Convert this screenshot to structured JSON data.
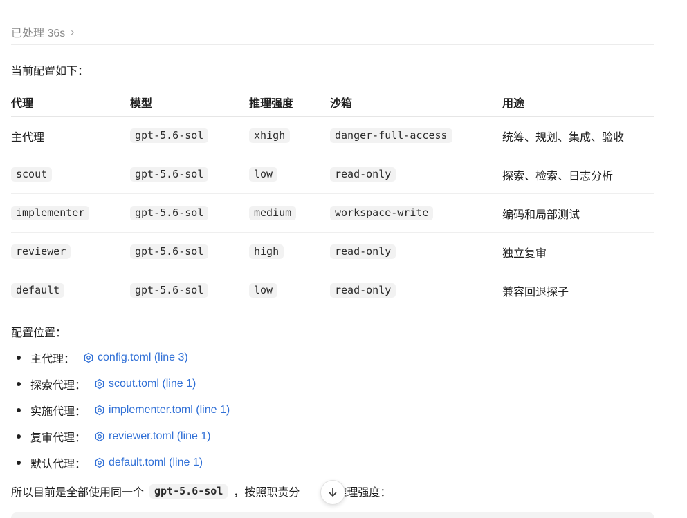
{
  "status": {
    "processed_label": "已处理 36s",
    "chevron": "›"
  },
  "intro": "当前配置如下：",
  "table": {
    "headers": [
      "代理",
      "模型",
      "推理强度",
      "沙箱",
      "用途"
    ],
    "rows": [
      {
        "agent": "主代理",
        "agent_is_code": false,
        "model": "gpt-5.6-sol",
        "effort": "xhigh",
        "sandbox": "danger-full-access",
        "usage": "统筹、规划、集成、验收"
      },
      {
        "agent": "scout",
        "agent_is_code": true,
        "model": "gpt-5.6-sol",
        "effort": "low",
        "sandbox": "read-only",
        "usage": "探索、检索、日志分析"
      },
      {
        "agent": "implementer",
        "agent_is_code": true,
        "model": "gpt-5.6-sol",
        "effort": "medium",
        "sandbox": "workspace-write",
        "usage": "编码和局部测试"
      },
      {
        "agent": "reviewer",
        "agent_is_code": true,
        "model": "gpt-5.6-sol",
        "effort": "high",
        "sandbox": "read-only",
        "usage": "独立复审"
      },
      {
        "agent": "default",
        "agent_is_code": true,
        "model": "gpt-5.6-sol",
        "effort": "low",
        "sandbox": "read-only",
        "usage": "兼容回退探子"
      }
    ]
  },
  "config_heading": "配置位置：",
  "config_items": [
    {
      "label": "主代理：",
      "link": "config.toml (line 3)"
    },
    {
      "label": "探索代理：",
      "link": "scout.toml (line 1)"
    },
    {
      "label": "实施代理：",
      "link": "implementer.toml (line 1)"
    },
    {
      "label": "复审代理：",
      "link": "reviewer.toml (line 1)"
    },
    {
      "label": "默认代理：",
      "link": "default.toml (line 1)"
    }
  ],
  "final": {
    "before": "所以目前是全部使用同一个",
    "code": "gpt-5.6-sol",
    "after": "，按照职责分",
    "after2": "同推理强度："
  },
  "colors": {
    "link": "#2f6fd6",
    "code_bg": "#f2f2f2",
    "muted": "#8a8a8a"
  },
  "icons": {
    "config_link_icon": "gear-icon",
    "scroll": "arrow-down-icon"
  }
}
